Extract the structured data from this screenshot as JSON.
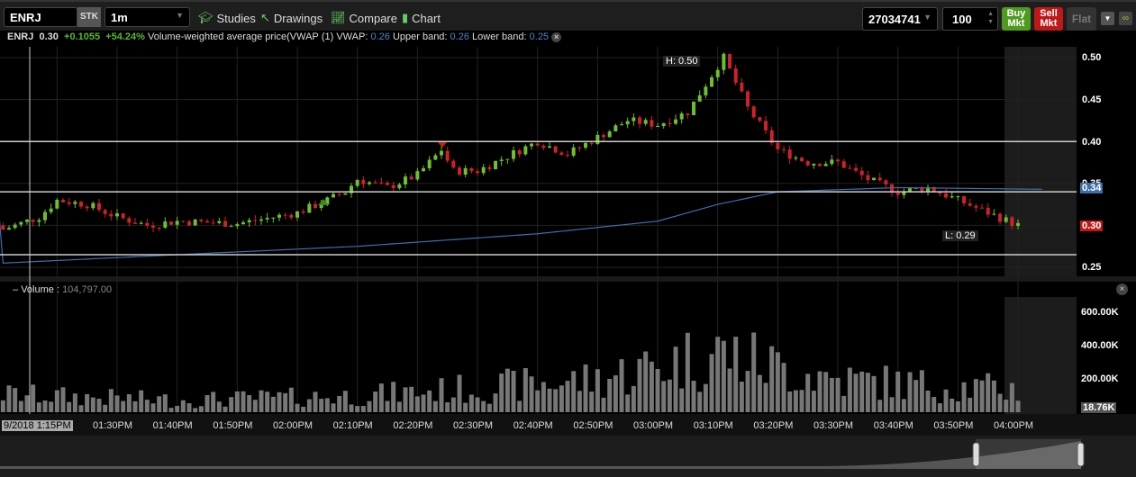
{
  "toolbar": {
    "symbol": "ENRJ",
    "sec_type": "STK",
    "interval": "1m",
    "studies": "Studies",
    "drawings": "Drawings",
    "compare": "Compare",
    "chart": "Chart",
    "account": "27034741",
    "quantity": "100",
    "buy": "Buy Mkt",
    "sell": "Sell Mkt",
    "flat": "Flat"
  },
  "info": {
    "symbol": "ENRJ",
    "last": "0.30",
    "change": "+0.1055",
    "change_pct": "+54.24%",
    "study": "Volume-weighted average price(VWAP",
    "param": "(1)",
    "vwap_label": "VWAP:",
    "vwap": "0.26",
    "upper_label": "Upper band:",
    "upper": "0.26",
    "lower_label": "Lower band:",
    "lower": "0.25"
  },
  "price_axis": [
    "0.50",
    "0.45",
    "0.40",
    "0.35",
    "0.25"
  ],
  "price_badges": {
    "vwap": "0.34",
    "last": "0.30"
  },
  "annotations": {
    "high": "H: 0.50",
    "low": "L: 0.29"
  },
  "volume": {
    "label": "Volume",
    "value": "104,797.00",
    "axis": [
      "600.00K",
      "400.00K",
      "200.00K"
    ],
    "last": "18.76K"
  },
  "time_axis": {
    "start": "9/2018 1:15PM",
    "labels": [
      "01:30PM",
      "01:40PM",
      "01:50PM",
      "02:00PM",
      "02:10PM",
      "02:20PM",
      "02:30PM",
      "02:40PM",
      "02:50PM",
      "03:00PM",
      "03:10PM",
      "03:20PM",
      "03:30PM",
      "03:40PM",
      "03:50PM",
      "04:00PM"
    ]
  },
  "chart_data": {
    "type": "candlestick",
    "price_range": [
      0.24,
      0.51
    ],
    "price_keyframes": [
      [
        11,
        0.295
      ],
      [
        17,
        0.31
      ],
      [
        20,
        0.33
      ],
      [
        25,
        0.325
      ],
      [
        30,
        0.31
      ],
      [
        35,
        0.3
      ],
      [
        40,
        0.305
      ],
      [
        50,
        0.302
      ],
      [
        60,
        0.315
      ],
      [
        65,
        0.33
      ],
      [
        68,
        0.34
      ],
      [
        70,
        0.355
      ],
      [
        75,
        0.345
      ],
      [
        80,
        0.36
      ],
      [
        84,
        0.39
      ],
      [
        86,
        0.365
      ],
      [
        90,
        0.365
      ],
      [
        100,
        0.4
      ],
      [
        105,
        0.385
      ],
      [
        110,
        0.405
      ],
      [
        115,
        0.425
      ],
      [
        120,
        0.42
      ],
      [
        125,
        0.435
      ],
      [
        130,
        0.49
      ],
      [
        131,
        0.5
      ],
      [
        135,
        0.44
      ],
      [
        140,
        0.39
      ],
      [
        145,
        0.375
      ],
      [
        150,
        0.375
      ],
      [
        155,
        0.355
      ],
      [
        160,
        0.34
      ],
      [
        165,
        0.345
      ],
      [
        170,
        0.33
      ],
      [
        175,
        0.315
      ],
      [
        180,
        0.3
      ]
    ],
    "vwap_keyframes": [
      [
        11,
        0.255
      ],
      [
        40,
        0.265
      ],
      [
        70,
        0.275
      ],
      [
        100,
        0.29
      ],
      [
        120,
        0.305
      ],
      [
        130,
        0.325
      ],
      [
        140,
        0.34
      ],
      [
        160,
        0.345
      ],
      [
        184,
        0.343
      ]
    ],
    "hlines": [
      0.4,
      0.34,
      0.265
    ],
    "volume_envelope_k": [
      [
        11,
        120
      ],
      [
        40,
        80
      ],
      [
        70,
        110
      ],
      [
        90,
        160
      ],
      [
        110,
        220
      ],
      [
        130,
        400
      ],
      [
        140,
        300
      ],
      [
        150,
        220
      ],
      [
        165,
        180
      ],
      [
        180,
        150
      ]
    ]
  }
}
